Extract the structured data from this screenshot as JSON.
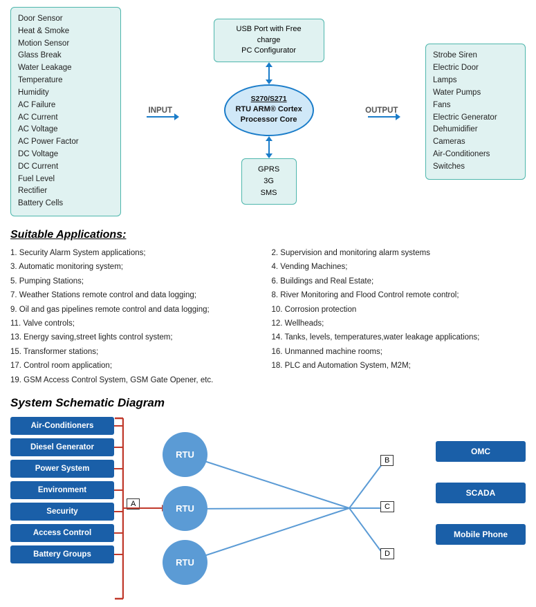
{
  "topDiagram": {
    "inputItems": [
      "Door Sensor",
      "Heat & Smoke",
      "Motion Sensor",
      "Glass Break",
      "Water Leakage",
      "Temperature",
      "Humidity",
      "AC Failure",
      "AC Current",
      "AC Voltage",
      "AC Power Factor",
      "DC Voltage",
      "DC Current",
      "Fuel Level",
      "Rectifier",
      "Battery Cells"
    ],
    "inputLabel": "INPUT",
    "outputLabel": "OUTPUT",
    "usbBox": "USB Port with Free charge\nPC Configurator",
    "rtuModel": "S270/S271",
    "rtuLabel": "RTU  ARM® Cortex\nProcessor Core",
    "gprsItems": [
      "GPRS",
      "3G",
      "SMS"
    ],
    "outputItems": [
      "Strobe Siren",
      "Electric Door",
      "Lamps",
      "Water Pumps",
      "Fans",
      "Electric Generator",
      "Dehumidifier",
      "Cameras",
      "Air-Conditioners",
      "Switches"
    ]
  },
  "suitableApplications": {
    "title": "Suitable Applications:",
    "items": [
      {
        "num": "1",
        "text": "Security Alarm System applications;"
      },
      {
        "num": "2",
        "text": "Supervision and monitoring alarm systems"
      },
      {
        "num": "3",
        "text": "Automatic monitoring system;"
      },
      {
        "num": "4",
        "text": "Vending Machines;"
      },
      {
        "num": "5",
        "text": "Pumping Stations;"
      },
      {
        "num": "6",
        "text": "Buildings and Real Estate;"
      },
      {
        "num": "7",
        "text": "Weather Stations remote control and data logging;"
      },
      {
        "num": "8",
        "text": "River Monitoring and Flood Control remote control;"
      },
      {
        "num": "9",
        "text": "Oil and gas pipelines remote control and data logging;"
      },
      {
        "num": "10",
        "text": "Corrosion protection"
      },
      {
        "num": "11",
        "text": "Valve controls;"
      },
      {
        "num": "12",
        "text": "Wellheads;"
      },
      {
        "num": "13",
        "text": "Energy saving,street lights control system;"
      },
      {
        "num": "14",
        "text": "Tanks, levels, temperatures,water leakage applications;"
      },
      {
        "num": "15",
        "text": "Transformer stations;"
      },
      {
        "num": "16",
        "text": "Unmanned machine rooms;"
      },
      {
        "num": "17",
        "text": "Control room application;"
      },
      {
        "num": "18",
        "text": "PLC and Automation System, M2M;"
      },
      {
        "num": "19",
        "text": "GSM Access Control System, GSM Gate Opener, etc.",
        "full": true
      }
    ]
  },
  "schematic": {
    "title": "System Schematic Diagram",
    "leftBoxes": [
      "Air-Conditioners",
      "Diesel Generator",
      "Power System",
      "Environment",
      "Security",
      "Access Control",
      "Battery Groups"
    ],
    "rtuLabel": "RTU",
    "labelA": "A",
    "labelB": "B",
    "labelC": "C",
    "labelD": "D",
    "rightBoxes": [
      "OMC",
      "SCADA",
      "Mobile Phone"
    ]
  }
}
